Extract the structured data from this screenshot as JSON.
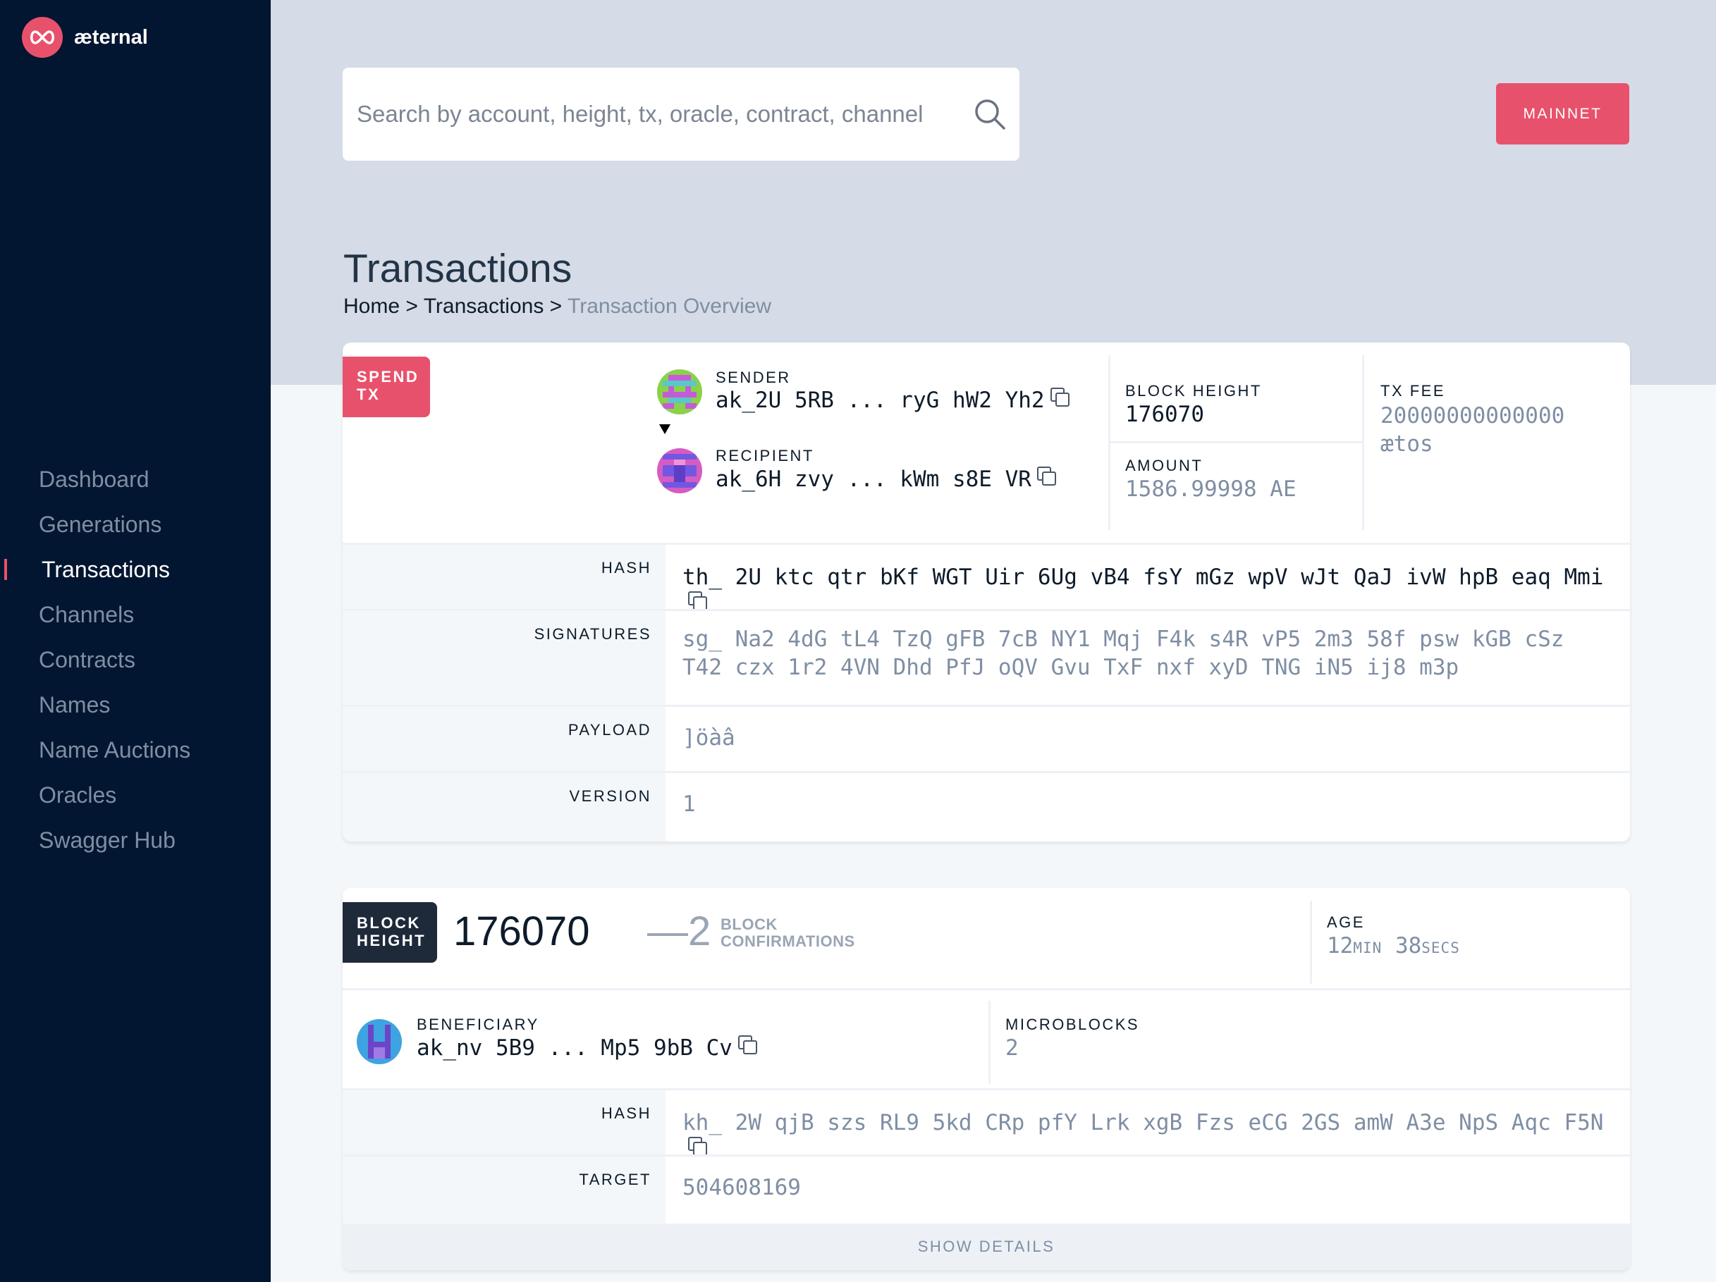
{
  "brand": {
    "name": "æternal",
    "accent": "#e8516c",
    "sidebar_bg": "#031631"
  },
  "nav": {
    "items": [
      {
        "label": "Dashboard"
      },
      {
        "label": "Generations"
      },
      {
        "label": "Transactions",
        "active": true
      },
      {
        "label": "Channels"
      },
      {
        "label": "Contracts"
      },
      {
        "label": "Names"
      },
      {
        "label": "Name Auctions"
      },
      {
        "label": "Oracles"
      },
      {
        "label": "Swagger Hub"
      }
    ]
  },
  "search": {
    "placeholder": "Search by account, height, tx, oracle, contract, channel",
    "icon": "search-icon"
  },
  "network": {
    "label": "MAINNET"
  },
  "page": {
    "title": "Transactions",
    "breadcrumb": {
      "home": "Home",
      "sep": ">",
      "section": "Transactions",
      "current": "Transaction Overview"
    }
  },
  "tx": {
    "type_line1": "SPEND",
    "type_line2": "TX",
    "sender_label": "SENDER",
    "sender": "ak_2U 5RB ... ryG hW2 Yh2",
    "recipient_label": "RECIPIENT",
    "recipient": "ak_6H zvy ... kWm s8E VR",
    "block_height_label": "BLOCK HEIGHT",
    "block_height": "176070",
    "amount_label": "AMOUNT",
    "amount": "1586.99998 AE",
    "fee_label": "TX FEE",
    "fee": "20000000000000 ætos",
    "hash_label": "HASH",
    "hash": "th_ 2U ktc qtr bKf WGT Uir 6Ug vB4 fsY mGz wpV wJt QaJ ivW hpB eaq Mmi",
    "signatures_label": "SIGNATURES",
    "signatures": "sg_ Na2 4dG tL4 TzQ gFB 7cB NY1 Mqj F4k s4R vP5 2m3 58f psw kGB cSz T42 czx 1r2 4VN Dhd PfJ oQV Gvu TxF nxf xyD TNG iN5 ij8 m3p",
    "payload_label": "PAYLOAD",
    "payload": "]öàâ",
    "version_label": "VERSION",
    "version": "1"
  },
  "block": {
    "badge_line1": "BLOCK",
    "badge_line2": "HEIGHT",
    "height": "176070",
    "confirmations": "—2",
    "conf_line1": "BLOCK",
    "conf_line2": "CONFIRMATIONS",
    "age_label": "AGE",
    "age_min": "12",
    "age_min_unit": "MIN",
    "age_sec": "38",
    "age_sec_unit": "SECS",
    "beneficiary_label": "BENEFICIARY",
    "beneficiary": "ak_nv 5B9 ... Mp5 9bB Cv",
    "microblocks_label": "MICROBLOCKS",
    "microblocks": "2",
    "hash_label": "HASH",
    "hash": "kh_ 2W qjB szs RL9 5kd CRp pfY Lrk xgB Fzs eCG 2GS amW A3e NpS Aqc F5N",
    "target_label": "TARGET",
    "target": "504608169",
    "show_details": "SHOW DETAILS"
  }
}
